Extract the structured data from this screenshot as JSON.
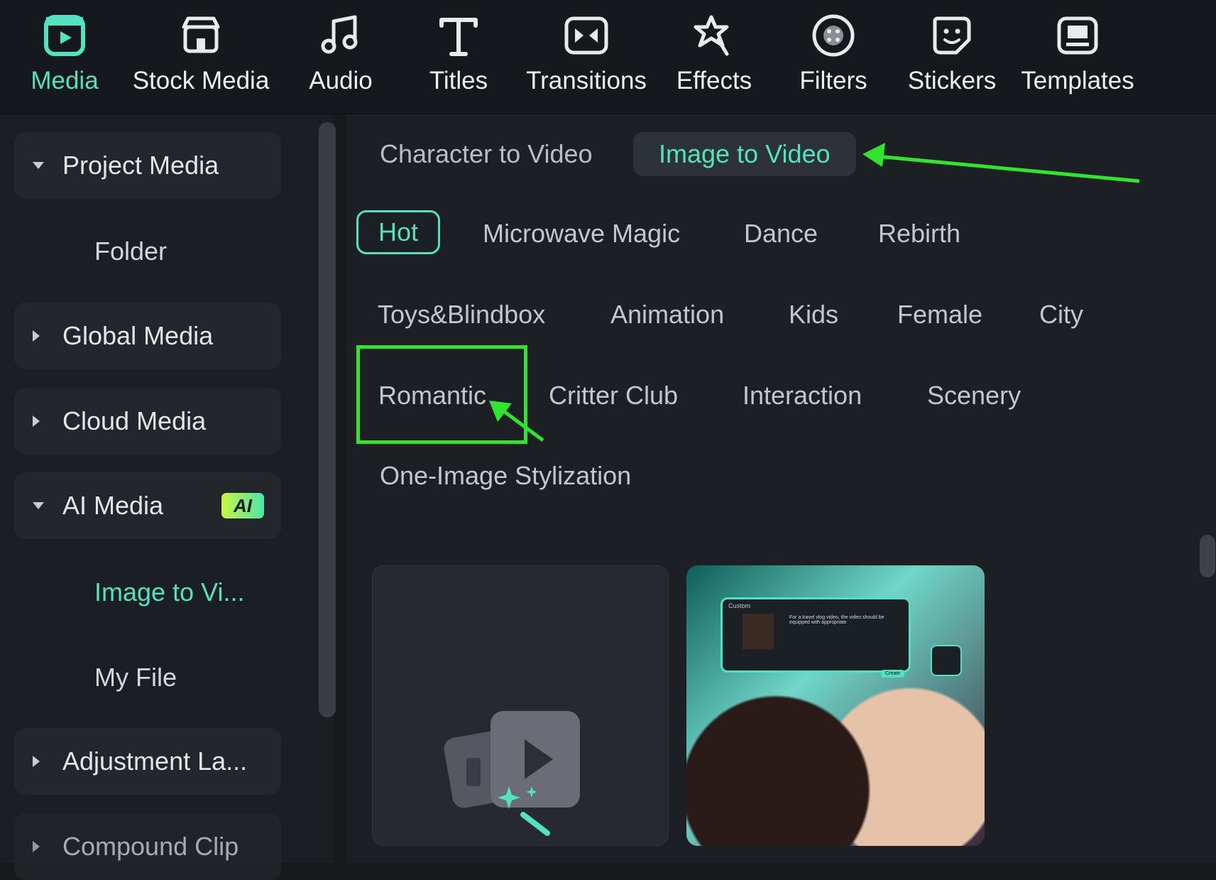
{
  "toolbar": {
    "items": [
      {
        "label": "Media",
        "icon": "media-icon",
        "active": true
      },
      {
        "label": "Stock Media",
        "icon": "stock-media-icon"
      },
      {
        "label": "Audio",
        "icon": "music-note-icon"
      },
      {
        "label": "Titles",
        "icon": "text-t-icon"
      },
      {
        "label": "Transitions",
        "icon": "transitions-icon"
      },
      {
        "label": "Effects",
        "icon": "effects-star-icon"
      },
      {
        "label": "Filters",
        "icon": "filters-icon"
      },
      {
        "label": "Stickers",
        "icon": "sticker-icon"
      },
      {
        "label": "Templates",
        "icon": "templates-icon"
      }
    ]
  },
  "sidebar": {
    "items": [
      {
        "label": "Project Media",
        "expanded": true
      },
      {
        "label": "Folder"
      },
      {
        "label": "Global Media",
        "expanded": false
      },
      {
        "label": "Cloud Media",
        "expanded": false
      },
      {
        "label": "AI Media",
        "expanded": true,
        "badge": "AI"
      },
      {
        "label": "Image to Vi...",
        "active": true
      },
      {
        "label": "My File"
      },
      {
        "label": "Adjustment La...",
        "expanded": false
      },
      {
        "label": "Compound Clip",
        "expanded": false
      }
    ]
  },
  "main": {
    "mode_tabs": [
      {
        "label": "Character to Video"
      },
      {
        "label": "Image to Video",
        "active": true
      }
    ],
    "categories": [
      {
        "label": "Hot",
        "active": true
      },
      {
        "label": "Microwave Magic"
      },
      {
        "label": "Dance"
      },
      {
        "label": "Rebirth"
      },
      {
        "label": "Toys&Blindbox"
      },
      {
        "label": "Animation"
      },
      {
        "label": "Kids"
      },
      {
        "label": "Female"
      },
      {
        "label": "City"
      },
      {
        "label": "Romantic",
        "highlighted": true
      },
      {
        "label": "Critter Club"
      },
      {
        "label": "Interaction"
      },
      {
        "label": "Scenery"
      },
      {
        "label": "One-Image Stylization"
      }
    ],
    "preview_card": {
      "panel_title": "Custom",
      "prompt_text": "For a travel vlog video, the video should be equipped with appropriate",
      "button_label": "Create"
    }
  },
  "colors": {
    "accent": "#52e2c1",
    "annotation_green": "#2fe62c",
    "background": "#1c1f23"
  }
}
